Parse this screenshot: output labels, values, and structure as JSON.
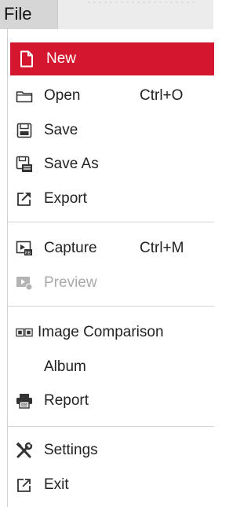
{
  "menubar": {
    "title": "File"
  },
  "menu": {
    "items": [
      {
        "id": "new",
        "label": "New",
        "shortcut": "",
        "icon": "new-file-icon",
        "state": "highlighted"
      },
      {
        "id": "open",
        "label": "Open",
        "shortcut": "Ctrl+O",
        "icon": "folder-icon",
        "state": "normal"
      },
      {
        "id": "save",
        "label": "Save",
        "shortcut": "",
        "icon": "save-icon",
        "state": "normal"
      },
      {
        "id": "save-as",
        "label": "Save As",
        "shortcut": "",
        "icon": "save-as-icon",
        "state": "normal"
      },
      {
        "id": "export",
        "label": "Export",
        "shortcut": "",
        "icon": "export-icon",
        "state": "normal"
      },
      {
        "id": "capture",
        "label": "Capture",
        "shortcut": "Ctrl+M",
        "icon": "capture-icon",
        "state": "normal"
      },
      {
        "id": "preview",
        "label": "Preview",
        "shortcut": "",
        "icon": "preview-icon",
        "state": "disabled"
      },
      {
        "id": "image-comparison",
        "label": "Image Comparison",
        "shortcut": "",
        "icon": "image-comparison-icon",
        "state": "normal"
      },
      {
        "id": "album",
        "label": "Album",
        "shortcut": "",
        "icon": "",
        "state": "normal"
      },
      {
        "id": "report",
        "label": "Report",
        "shortcut": "",
        "icon": "printer-icon",
        "state": "normal"
      },
      {
        "id": "settings",
        "label": "Settings",
        "shortcut": "",
        "icon": "tools-icon",
        "state": "normal"
      },
      {
        "id": "exit",
        "label": "Exit",
        "shortcut": "",
        "icon": "exit-icon",
        "state": "normal"
      }
    ]
  },
  "colors": {
    "highlight": "#d4172e",
    "text": "#222222",
    "disabled_text": "#a9a9a9",
    "menubar_bg": "#ececec",
    "menu_title_bg": "#d6d6d6",
    "separator": "#d5d5d5"
  }
}
